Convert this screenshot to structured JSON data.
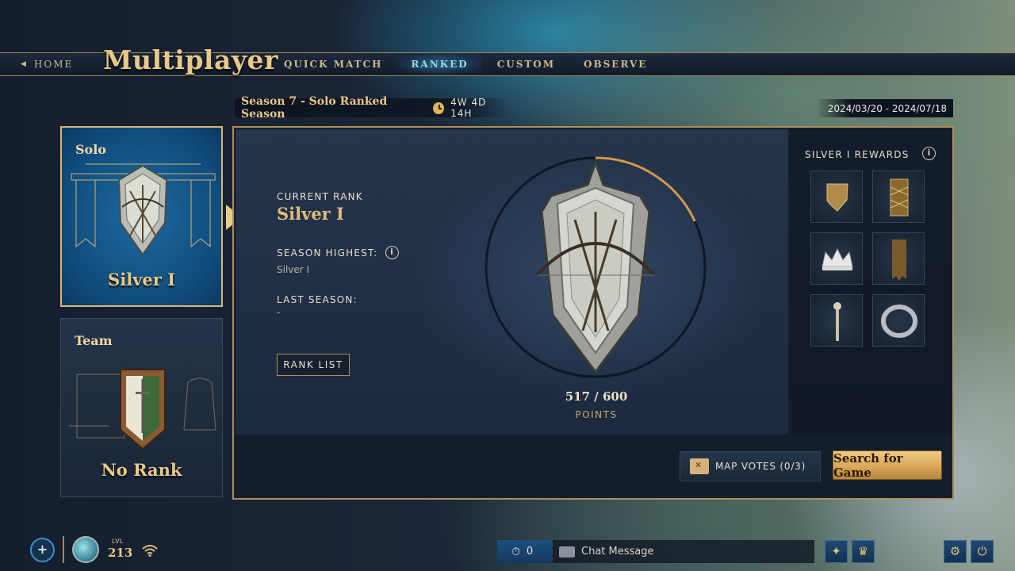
{
  "nav": {
    "home_label": "HOME",
    "title": "Multiplayer",
    "tabs": [
      {
        "label": "QUICK MATCH",
        "active": false
      },
      {
        "label": "RANKED",
        "active": true
      },
      {
        "label": "CUSTOM",
        "active": false
      },
      {
        "label": "OBSERVE",
        "active": false
      }
    ]
  },
  "season": {
    "title": "Season 7 - Solo Ranked Season",
    "timer": "4W 4D 14H",
    "dates": "2024/03/20 - 2024/07/18"
  },
  "queues": {
    "solo": {
      "label": "Solo",
      "rank": "Silver I",
      "selected": true
    },
    "team": {
      "label": "Team",
      "rank": "No Rank",
      "selected": false
    }
  },
  "rank": {
    "current_label": "CURRENT RANK",
    "current_value": "Silver I",
    "highest_label": "SEASON HIGHEST:",
    "highest_value": "Silver I",
    "last_label": "LAST SEASON:",
    "last_value": "-",
    "rank_list_label": "RANK LIST",
    "points_text": "517 / 600",
    "points_label": "POINTS",
    "points_current": 517,
    "points_max": 600
  },
  "rewards": {
    "title": "SILVER I REWARDS",
    "items": [
      "shield-icon",
      "banner-pattern-icon",
      "crown-icon",
      "banner-icon",
      "scepter-icon",
      "ring-icon"
    ]
  },
  "actions": {
    "map_votes_label": "MAP VOTES (0/3)",
    "search_label": "Search for Game"
  },
  "footer": {
    "add_label": "+",
    "level_label": "LVL",
    "level_value": "213",
    "queue_count": "0",
    "chat_placeholder": "Chat Message"
  },
  "colors": {
    "accent_gold": "#e9c98a",
    "selected_blue": "#1d6aa0",
    "button_gold": "#d9a858"
  }
}
